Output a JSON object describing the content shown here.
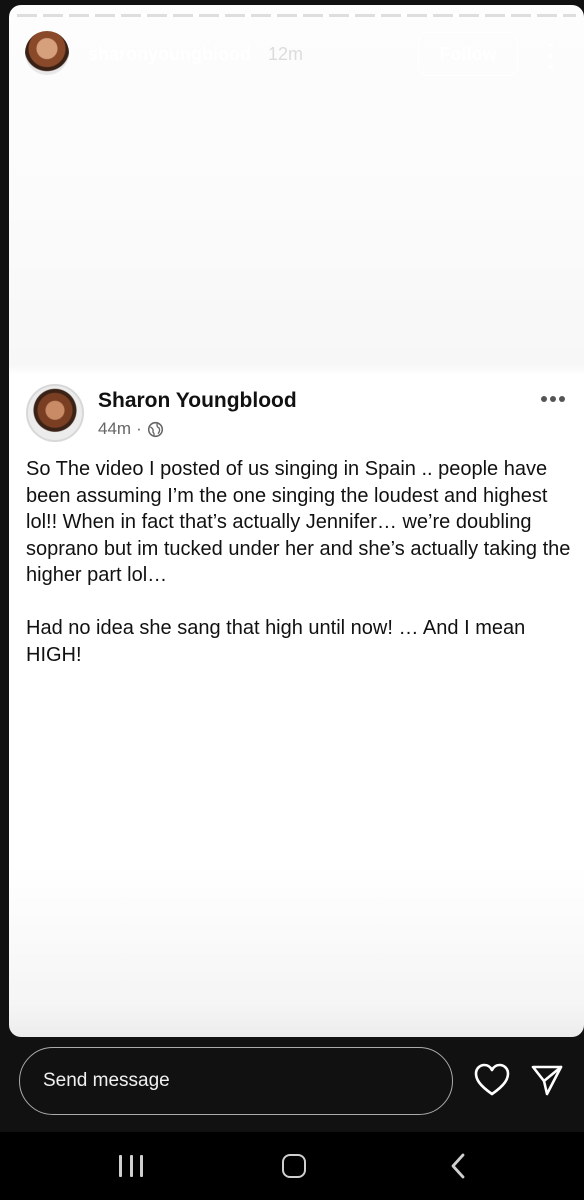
{
  "story": {
    "username": "sharonyoungblood",
    "time": "12m",
    "follow_label": "Follow",
    "more_icon": "more-vertical-icon"
  },
  "post": {
    "author": "Sharon Youngblood",
    "time": "44m",
    "separator": "·",
    "privacy_icon": "globe-icon",
    "more_icon": "more-horizontal-icon",
    "text": "So The video I posted of us singing in Spain .. people have been assuming I’m the one singing the loudest and highest lol!! When in fact that’s actually Jennifer… we’re doubling soprano but im tucked under her  and she’s actually taking the higher part lol…\n\nHad no idea she sang that high until now! … And I mean HIGH!"
  },
  "reply": {
    "placeholder": "Send message",
    "like_icon": "heart-icon",
    "send_icon": "send-icon"
  },
  "nav": {
    "recent_icon": "recent-apps-icon",
    "home_icon": "home-icon",
    "back_icon": "back-icon"
  }
}
